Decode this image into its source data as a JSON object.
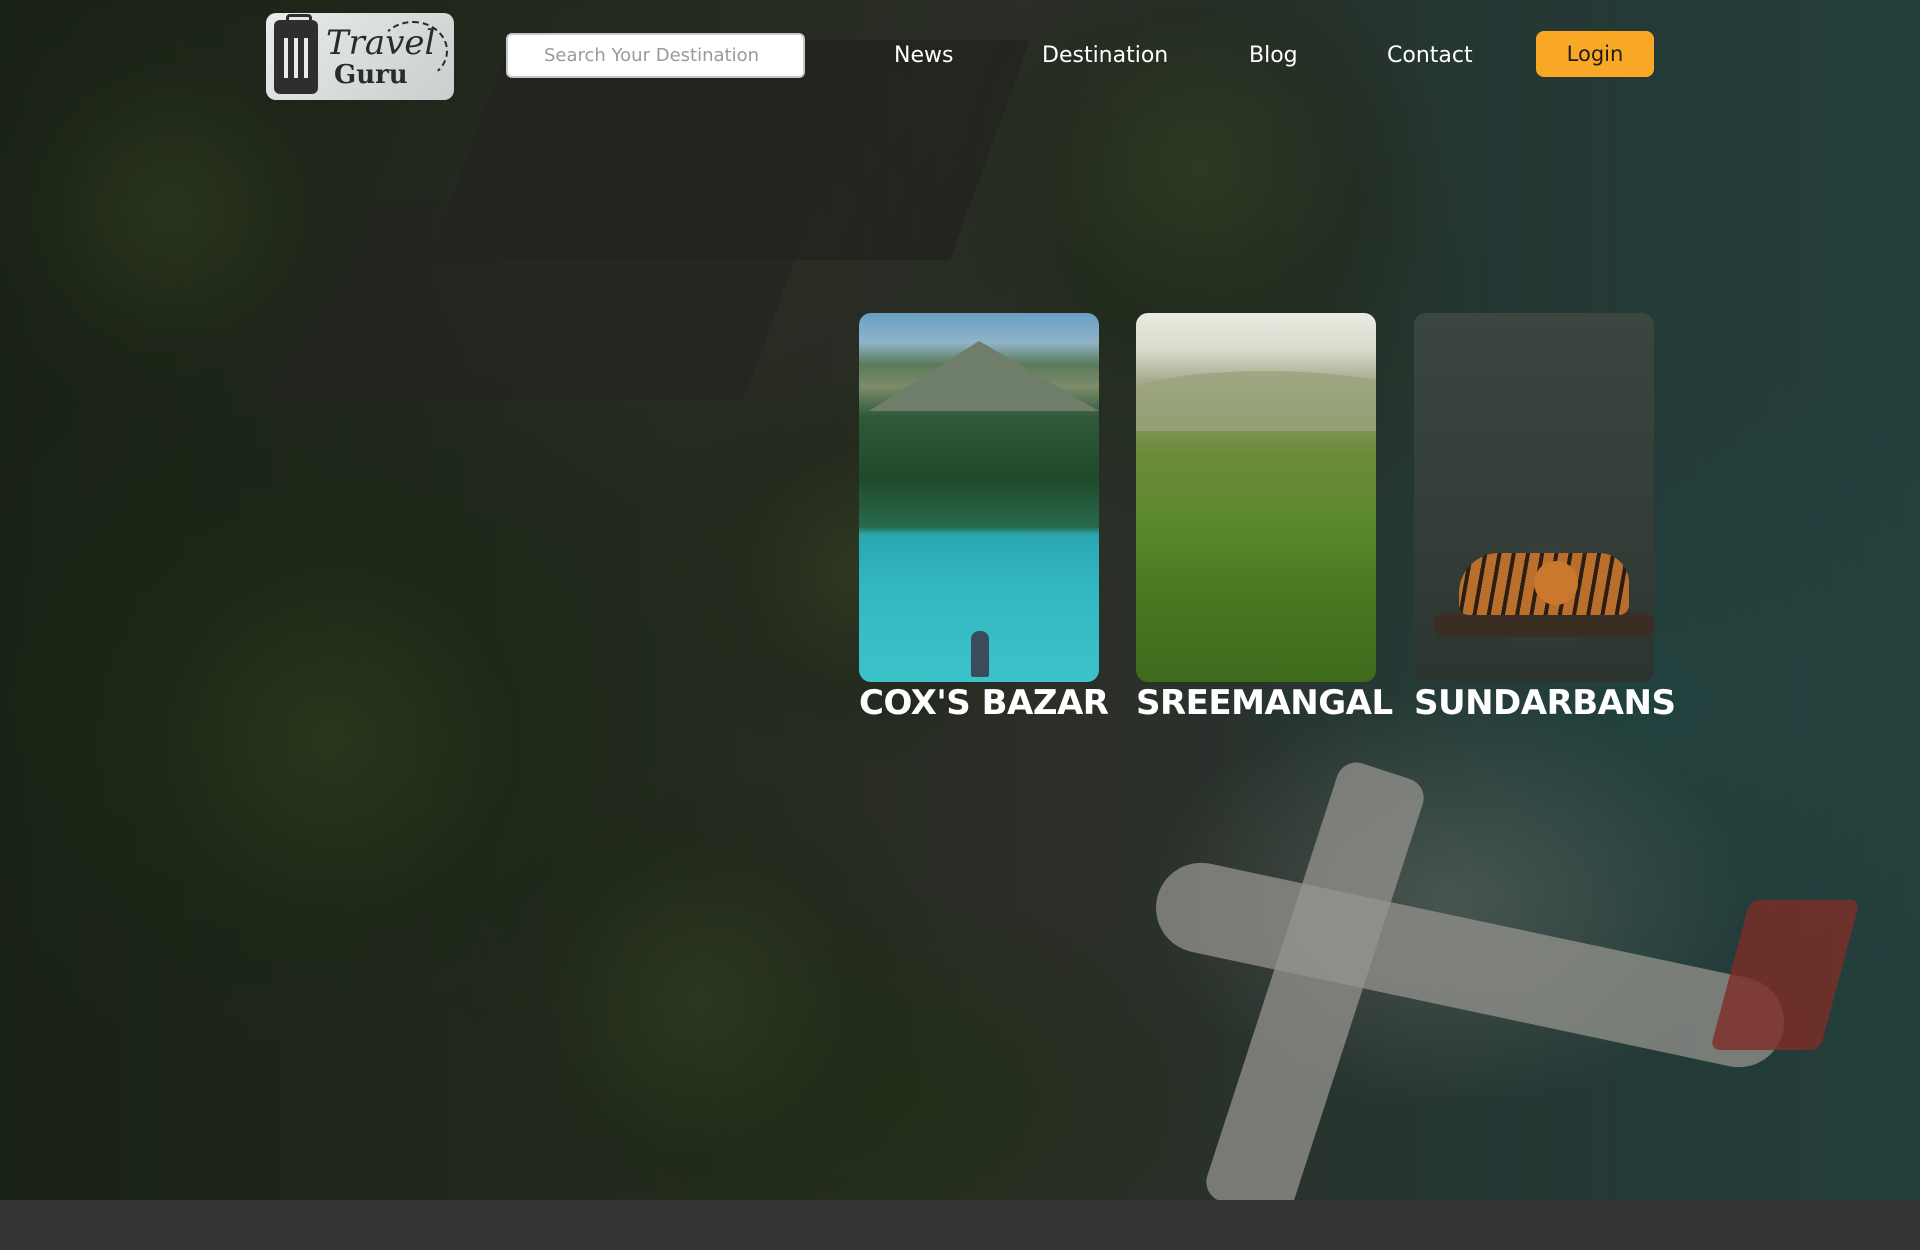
{
  "header": {
    "logo": {
      "line1": "Travel",
      "line2": "Guru"
    },
    "search": {
      "placeholder": "Search Your Destination",
      "value": ""
    },
    "nav": [
      "News",
      "Destination",
      "Blog",
      "Contact"
    ],
    "login_label": "Login"
  },
  "destinations": [
    {
      "name": "COX'S BAZAR"
    },
    {
      "name": "SREEMANGAL"
    },
    {
      "name": "SUNDARBANS"
    }
  ],
  "colors": {
    "accent": "#f9a825",
    "footer": "#333333",
    "text": "#ffffff"
  },
  "icons": [
    "suitcase-icon"
  ]
}
